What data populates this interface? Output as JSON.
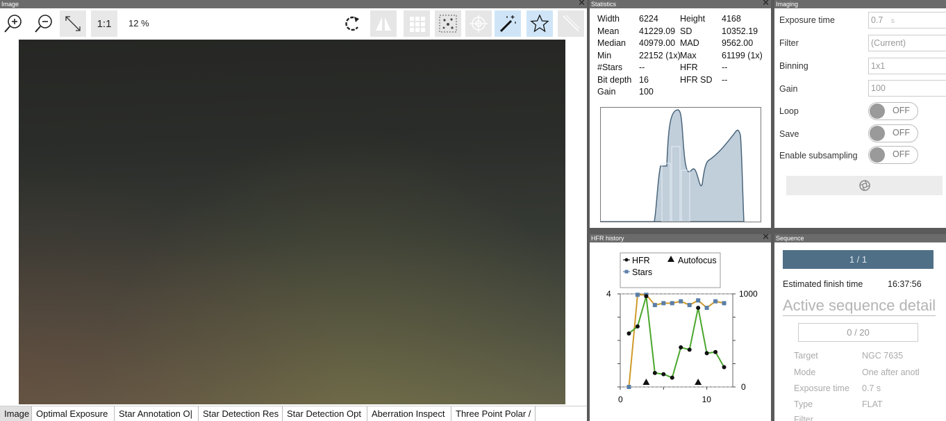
{
  "image_pane": {
    "title": "Image",
    "zoom_label": "1:1",
    "zoom_percent": "12 %",
    "tabs": [
      "Image",
      "Optimal Exposure",
      "Star Annotation O|",
      "Star Detection Res",
      "Star Detection Opt",
      "Aberration Inspect",
      "Three Point Polar /"
    ]
  },
  "statistics": {
    "title": "Statistics",
    "rows": [
      {
        "k1": "Width",
        "v1": "6224",
        "k2": "Height",
        "v2": "4168"
      },
      {
        "k1": "Mean",
        "v1": "41229.09",
        "k2": "SD",
        "v2": "10352.19"
      },
      {
        "k1": "Median",
        "v1": "40979.00",
        "k2": "MAD",
        "v2": "9562.00"
      },
      {
        "k1": "Min",
        "v1": "22152 (1x)",
        "k2": "Max",
        "v2": "61199 (1x)"
      },
      {
        "k1": "#Stars",
        "v1": "--",
        "k2": "HFR",
        "v2": "--"
      },
      {
        "k1": "Bit depth",
        "v1": "16",
        "k2": "HFR SD",
        "v2": "--"
      },
      {
        "k1": "Gain",
        "v1": "100",
        "k2": "",
        "v2": ""
      }
    ]
  },
  "hfr_history": {
    "title": "HFR history",
    "legend": {
      "hfr": "HFR",
      "autofocus": "Autofocus",
      "stars": "Stars"
    },
    "colors": {
      "hfr": "#4aa62c",
      "stars": "#d09a2a",
      "autofocus": "#111111"
    }
  },
  "chart_data": {
    "type": "line",
    "x": [
      1,
      2,
      3,
      4,
      5,
      6,
      7,
      8,
      9,
      10,
      11,
      12
    ],
    "series": [
      {
        "name": "HFR",
        "axis": "left",
        "values": [
          2.3,
          2.6,
          3.9,
          0.6,
          0.55,
          0.4,
          1.7,
          1.6,
          3.4,
          1.45,
          1.5,
          0.85
        ]
      },
      {
        "name": "Stars",
        "axis": "right",
        "values": [
          0,
          990,
          990,
          880,
          900,
          900,
          920,
          880,
          930,
          850,
          920,
          900
        ]
      }
    ],
    "autofocus_x": [
      3,
      9
    ],
    "x_ticks": [
      "0",
      "10"
    ],
    "y_left_ticks": [
      "4"
    ],
    "y_right_ticks": [
      "1000",
      "0"
    ],
    "xlim": [
      0,
      13
    ],
    "ylim_left": [
      0,
      4
    ],
    "ylim_right": [
      0,
      1000
    ]
  },
  "imaging": {
    "title": "Imaging",
    "exposure_label": "Exposure time",
    "exposure_value": "0.7",
    "exposure_unit": "s",
    "filter_label": "Filter",
    "filter_value": "(Current)",
    "binning_label": "Binning",
    "binning_value": "1x1",
    "gain_label": "Gain",
    "gain_value": "100",
    "loop_label": "Loop",
    "loop_state": "OFF",
    "save_label": "Save",
    "save_state": "OFF",
    "subsampling_label": "Enable subsampling",
    "subsampling_state": "OFF"
  },
  "sequence": {
    "title": "Sequence",
    "progress": "1 / 1",
    "finish_label": "Estimated finish time",
    "finish_time": "16:37:56",
    "heading": "Active sequence detail",
    "count": "0 / 20",
    "target_label": "Target",
    "target_value": "NGC 7635",
    "mode_label": "Mode",
    "mode_value": "One after anotl",
    "exposure_label": "Exposure time",
    "exposure_value": "0.7 s",
    "type_label": "Type",
    "type_value": "FLAT",
    "filter_label": "Filter"
  }
}
